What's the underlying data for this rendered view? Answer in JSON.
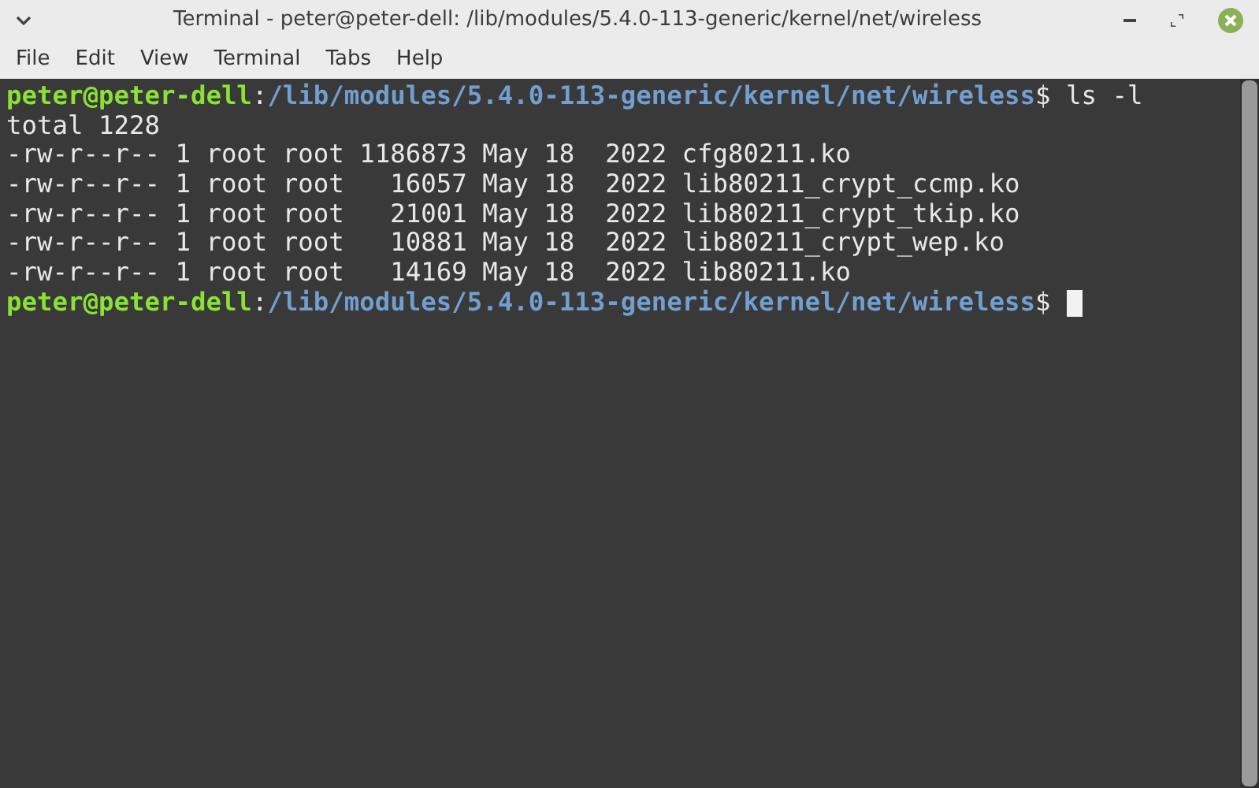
{
  "window": {
    "title": "Terminal - peter@peter-dell: /lib/modules/5.4.0-113-generic/kernel/net/wireless"
  },
  "menu": [
    "File",
    "Edit",
    "View",
    "Terminal",
    "Tabs",
    "Help"
  ],
  "lines": [
    {
      "kind": "prompt",
      "user": "peter@peter-dell",
      "colon": ":",
      "path": "/lib/modules/5.4.0-113-generic/kernel/net/wireless",
      "symbol": "$",
      "command": " ls -l",
      "cursor": false
    },
    {
      "kind": "output",
      "text": "total 1228"
    },
    {
      "kind": "output",
      "text": "-rw-r--r-- 1 root root 1186873 May 18  2022 cfg80211.ko"
    },
    {
      "kind": "output",
      "text": "-rw-r--r-- 1 root root   16057 May 18  2022 lib80211_crypt_ccmp.ko"
    },
    {
      "kind": "output",
      "text": "-rw-r--r-- 1 root root   21001 May 18  2022 lib80211_crypt_tkip.ko"
    },
    {
      "kind": "output",
      "text": "-rw-r--r-- 1 root root   10881 May 18  2022 lib80211_crypt_wep.ko"
    },
    {
      "kind": "output",
      "text": "-rw-r--r-- 1 root root   14169 May 18  2022 lib80211.ko"
    },
    {
      "kind": "prompt",
      "user": "peter@peter-dell",
      "colon": ":",
      "path": "/lib/modules/5.4.0-113-generic/kernel/net/wireless",
      "symbol": "$",
      "cursor": true
    }
  ]
}
